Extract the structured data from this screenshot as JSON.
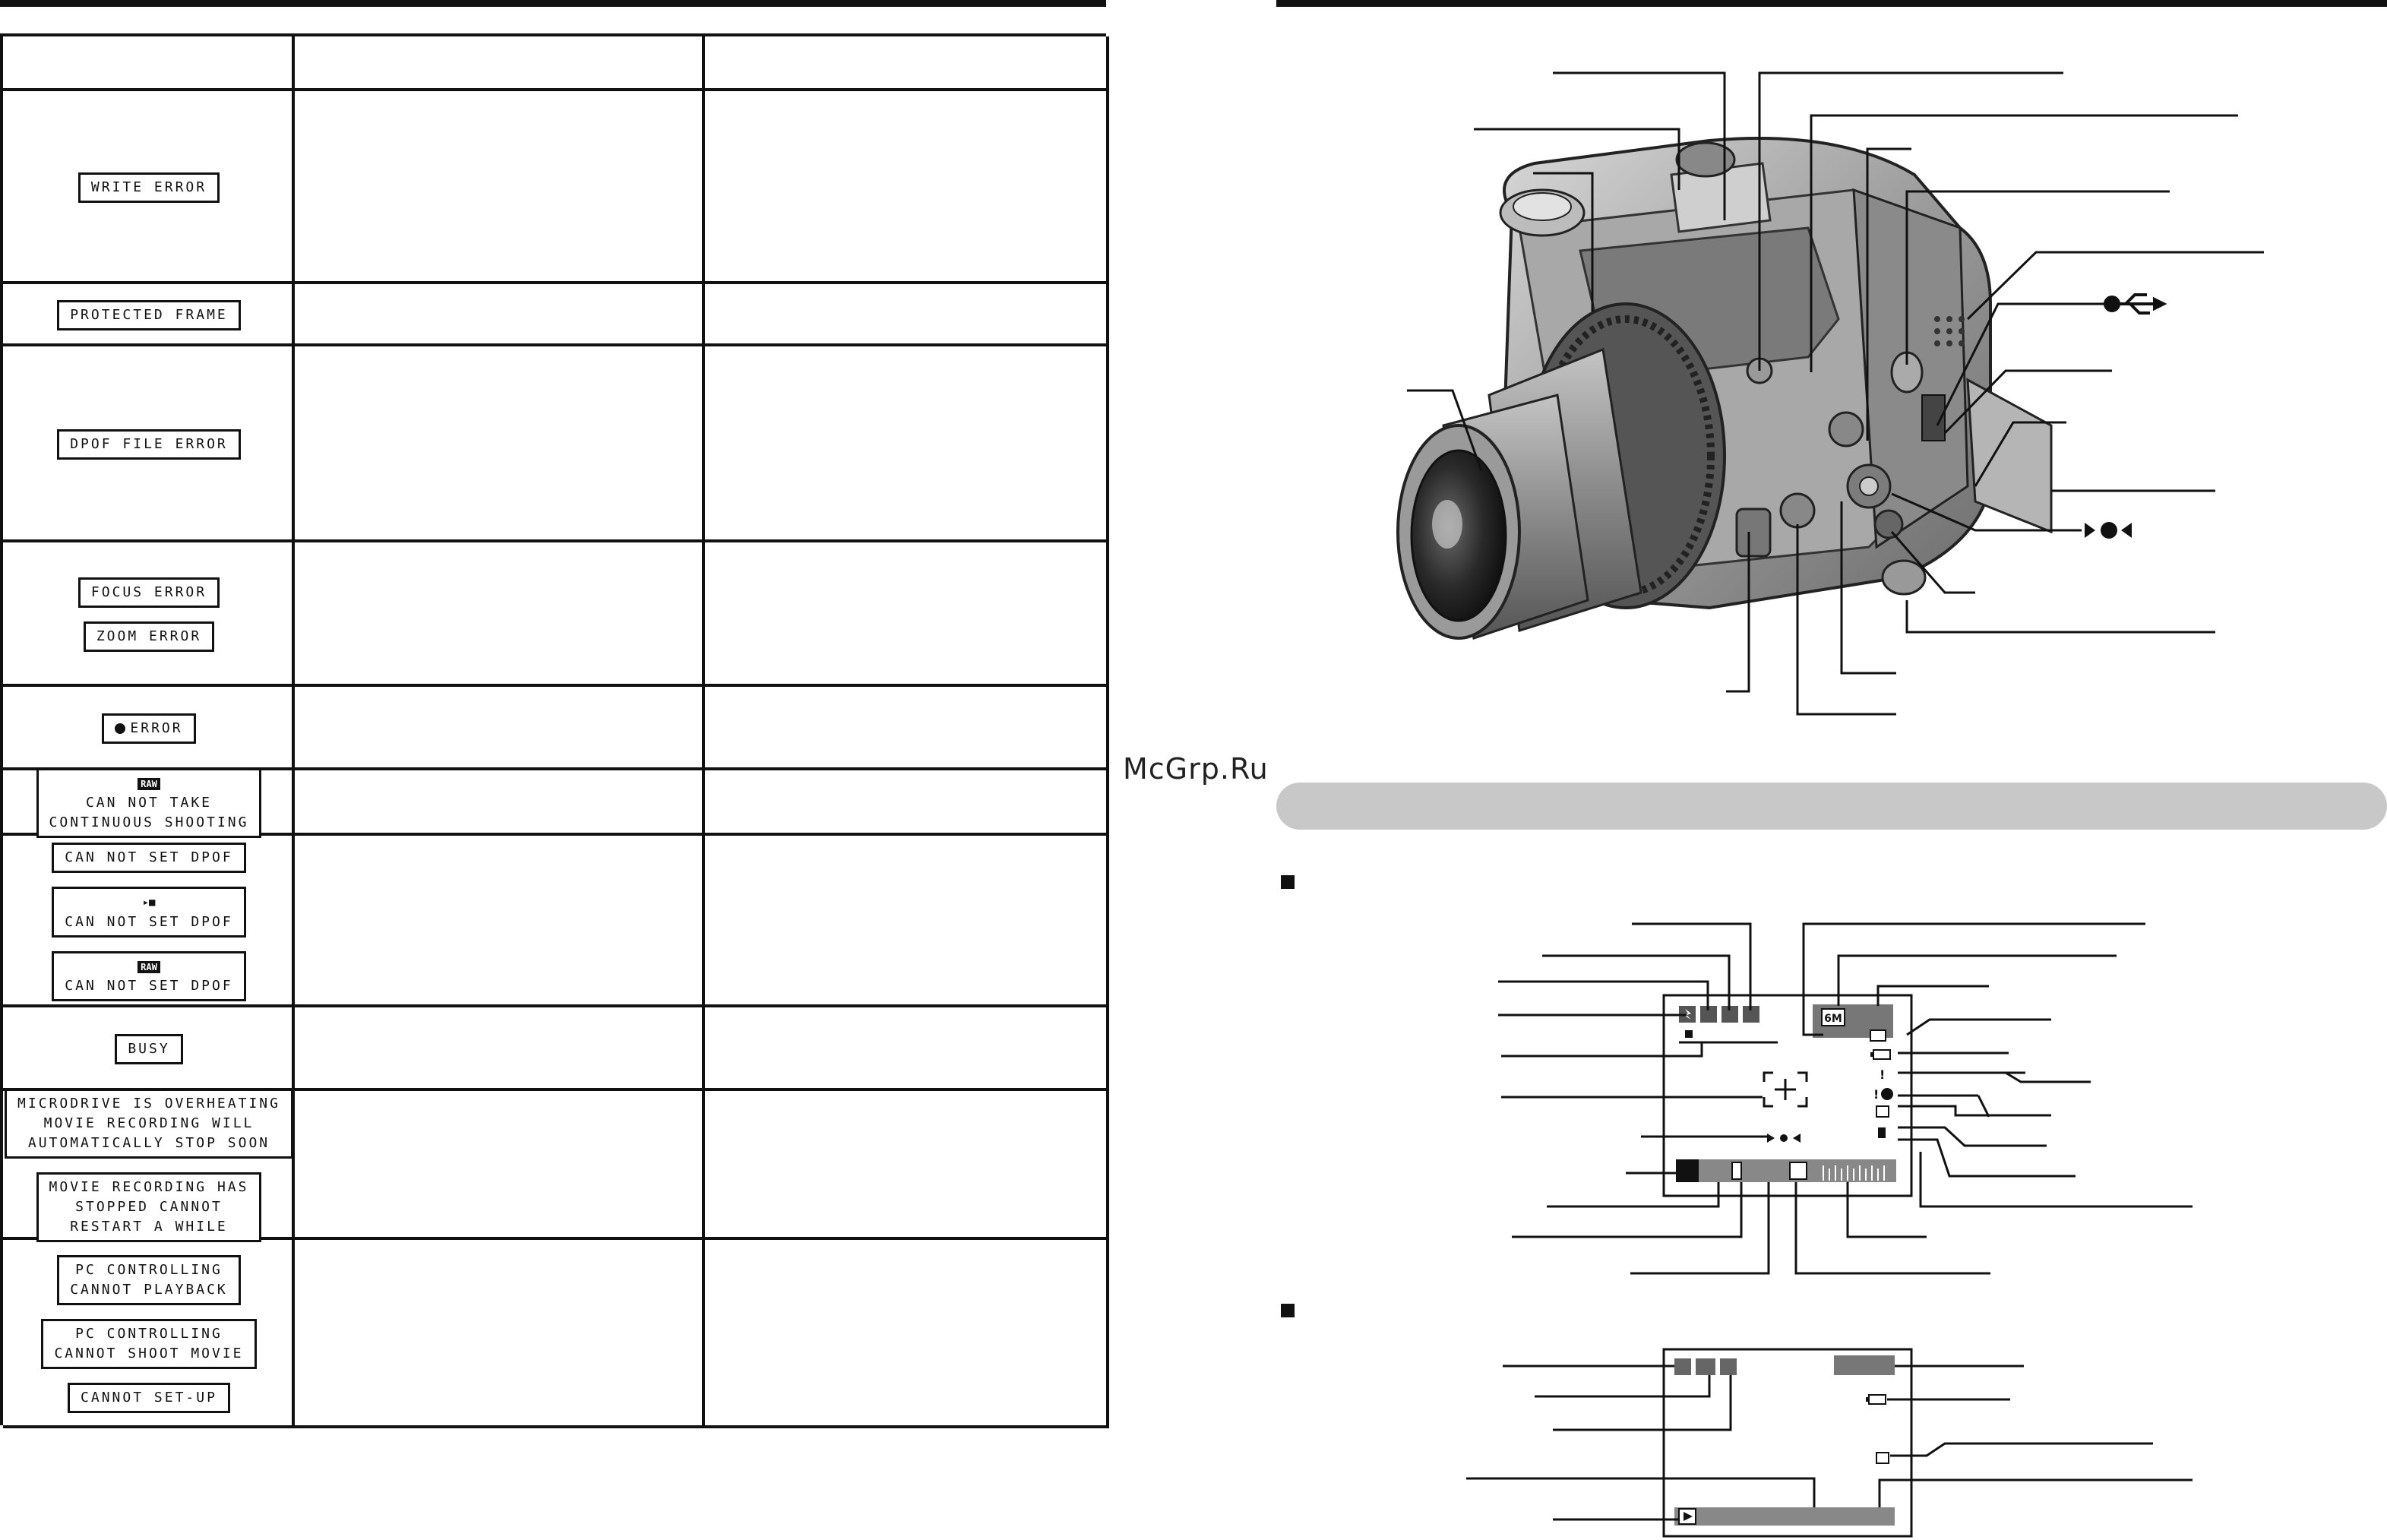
{
  "watermark": "McGrp.Ru",
  "error_table": {
    "rows": [
      {
        "messages": [
          {
            "lines": [
              "WRITE ERROR"
            ]
          }
        ]
      },
      {
        "messages": [
          {
            "lines": [
              "PROTECTED FRAME"
            ]
          }
        ]
      },
      {
        "messages": [
          {
            "lines": [
              "DPOF FILE ERROR"
            ]
          }
        ]
      },
      {
        "messages": [
          {
            "lines": [
              "FOCUS ERROR"
            ]
          },
          {
            "lines": [
              "ZOOM ERROR"
            ]
          }
        ]
      },
      {
        "messages": [
          {
            "icon": "microphone-icon",
            "lines": [
              "ERROR"
            ]
          }
        ]
      },
      {
        "messages": [
          {
            "tag": "RAW",
            "lines": [
              "CAN NOT TAKE",
              "CONTINUOUS SHOOTING"
            ]
          }
        ]
      },
      {
        "messages": [
          {
            "lines": [
              "CAN NOT SET DPOF"
            ]
          },
          {
            "icon": "movie-icon",
            "lines": [
              "CAN NOT SET DPOF"
            ]
          },
          {
            "tag": "RAW",
            "lines": [
              "CAN NOT SET DPOF"
            ]
          }
        ]
      },
      {
        "messages": [
          {
            "lines": [
              "BUSY"
            ]
          }
        ]
      },
      {
        "messages": [
          {
            "lines": [
              "MICRODRIVE IS OVERHEATING",
              "MOVIE RECORDING WILL",
              "AUTOMATICALLY STOP SOON"
            ]
          },
          {
            "lines": [
              "MOVIE RECORDING HAS",
              "STOPPED CANNOT",
              "RESTART A WHILE"
            ]
          }
        ]
      },
      {
        "messages": [
          {
            "lines": [
              "PC CONTROLLING",
              "CANNOT PLAYBACK"
            ]
          },
          {
            "lines": [
              "PC CONTROLLING",
              "CANNOT SHOOT MOVIE"
            ]
          },
          {
            "lines": [
              "CANNOT SET-UP"
            ]
          }
        ]
      }
    ]
  },
  "camera_diagram": {
    "icons": [
      "usb-icon",
      "av-out-icon"
    ]
  },
  "shooting_display": {
    "resolution_badge": "6M"
  },
  "colors": {
    "section_bar": "#c8c8c8",
    "lines": "#111111",
    "lcd_fill": "#777777"
  }
}
